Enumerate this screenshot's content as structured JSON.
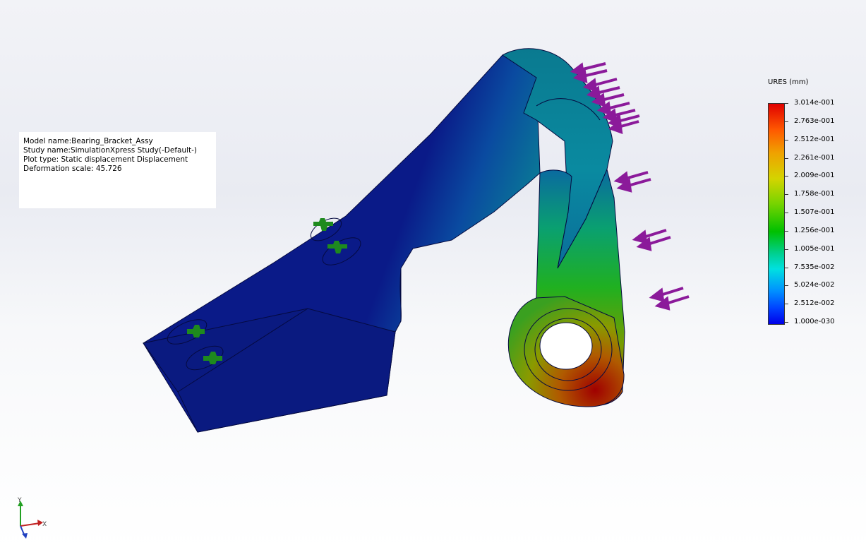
{
  "info": {
    "model_name": "Model name:Bearing_Bracket_Assy",
    "study_name": "Study name:SimulationXpress Study(-Default-)",
    "plot_type": "Plot type: Static displacement Displacement",
    "deformation_scale": "Deformation scale: 45.726"
  },
  "legend": {
    "title": "URES (mm)",
    "values": [
      "3.014e-001",
      "2.763e-001",
      "2.512e-001",
      "2.261e-001",
      "2.009e-001",
      "1.758e-001",
      "1.507e-001",
      "1.256e-001",
      "1.005e-001",
      "7.535e-002",
      "5.024e-002",
      "2.512e-002",
      "1.000e-030"
    ]
  },
  "triad": {
    "y_label": "Y",
    "x_label": "X"
  },
  "colors": {
    "load_arrow": "#8b1a9a",
    "fixture": "#1e8a1e",
    "part_low": "#0a1e8c"
  }
}
